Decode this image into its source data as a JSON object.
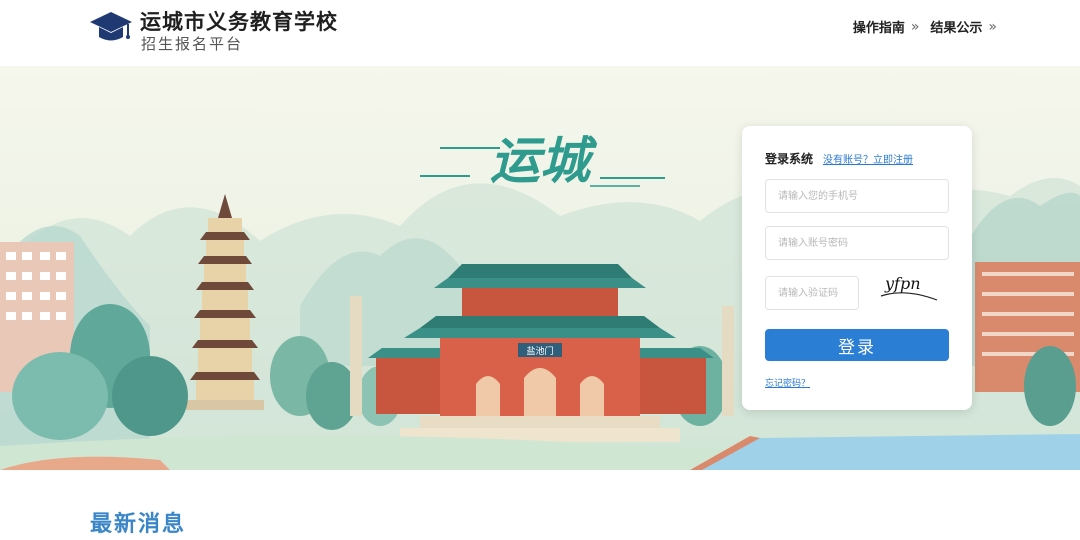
{
  "header": {
    "title": "运城市义务教育学校",
    "subtitle": "招生报名平台",
    "nav": [
      {
        "label": "操作指南",
        "chevron": "»"
      },
      {
        "label": "结果公示",
        "chevron": "»"
      }
    ]
  },
  "banner": {
    "calligraphy": "运城",
    "gate_plaque": "盐池门"
  },
  "login": {
    "title": "登录系统",
    "register_link": "没有账号？立即注册",
    "phone_placeholder": "请输入您的手机号",
    "password_placeholder": "请输入账号密码",
    "captcha_placeholder": "请输入验证码",
    "captcha_text": "yfpn",
    "submit_label": "登录",
    "forgot_link": "忘记密码？"
  },
  "news": {
    "title": "最新消息"
  },
  "colors": {
    "accent_blue": "#2a7fd4",
    "link_blue": "#2a7ad3",
    "brand_navy": "#1f3a73",
    "calligraphy_teal": "#2f9a8e",
    "roof_teal": "#3a8f86",
    "wall_red": "#c8553d"
  },
  "icons": {
    "logo": "graduation-cap-icon"
  }
}
